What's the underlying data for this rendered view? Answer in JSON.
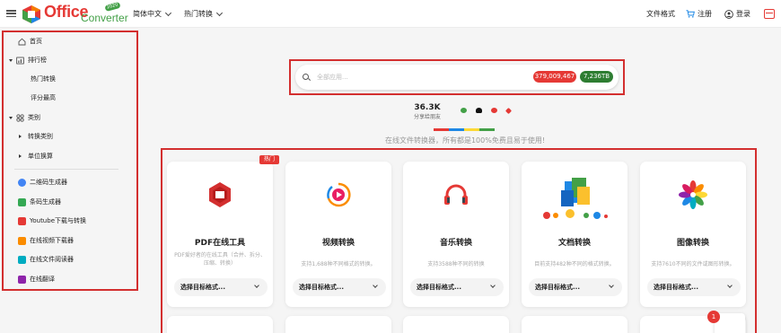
{
  "header": {
    "logo_text": "Office",
    "logo_sub": "Converter",
    "logo_badge": "2020",
    "nav": [
      {
        "label": "简体中文"
      },
      {
        "label": "热门转换"
      }
    ],
    "file_formats": "文件格式",
    "register": "注册",
    "login": "登录"
  },
  "sidebar": {
    "home": "首页",
    "ranking": "排行榜",
    "hot_conversion": "热门转换",
    "top_rated": "评分最高",
    "categories": "类别",
    "conversion_category": "转换类别",
    "unit_conversion": "单位换算",
    "tools": [
      {
        "label": "二维码生成器",
        "icon": "qr-icon",
        "color": "#4285f4"
      },
      {
        "label": "条码生成器",
        "icon": "barcode-icon",
        "color": "#34a853"
      },
      {
        "label": "Youtube下载与转换",
        "icon": "youtube-icon",
        "color": "#e53935"
      },
      {
        "label": "在线视频下载器",
        "icon": "video-download-icon",
        "color": "#fb8c00"
      },
      {
        "label": "在线文件阅读器",
        "icon": "file-reader-icon",
        "color": "#00acc1"
      },
      {
        "label": "在线翻译",
        "icon": "translate-icon",
        "color": "#8e24aa"
      }
    ]
  },
  "search": {
    "placeholder": "全部应用...",
    "count_a": "379,009,467",
    "count_b": "7,236TB",
    "color_a": "#e53935",
    "color_b": "#2e7d32"
  },
  "share": {
    "count": "36.3K",
    "label": "分享给朋友"
  },
  "tagline": "在线文件转换器，所有都是100%免费且易于使用!",
  "hot_badge": "热门",
  "cards": [
    {
      "title": "PDF在线工具",
      "desc": "PDF爱好者的在线工具（合并、拆分、压缩、转换）",
      "select": "选择目标格式...",
      "icon": "pdf-icon"
    },
    {
      "title": "视频转换",
      "desc": "支持1,688种不同格式的转换。",
      "select": "选择目标格式...",
      "icon": "video-icon"
    },
    {
      "title": "音乐转换",
      "desc": "支持3588种不同的转换",
      "select": "选择目标格式...",
      "icon": "headphones-icon"
    },
    {
      "title": "文档转换",
      "desc": "目前支持482种不同的格式转换。",
      "select": "选择目标格式...",
      "icon": "documents-icon"
    },
    {
      "title": "图像转换",
      "desc": "支持7610不同的文件或图形转换。",
      "select": "选择目标格式...",
      "icon": "image-flower-icon"
    }
  ],
  "notification_count": "1"
}
